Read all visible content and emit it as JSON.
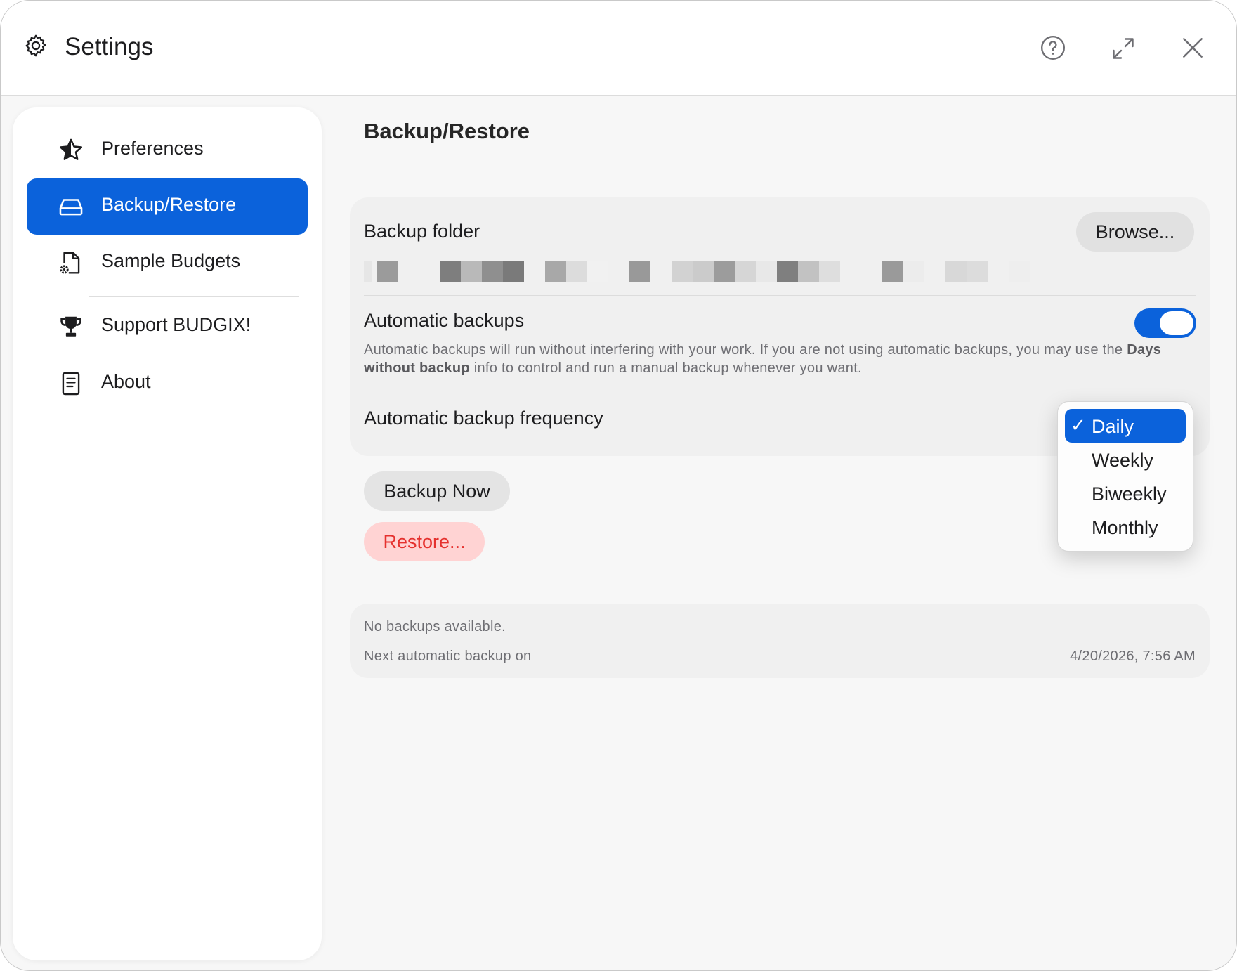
{
  "window": {
    "title": "Settings",
    "controls": [
      "help-icon",
      "expand-icon",
      "close-icon"
    ]
  },
  "sidebar": {
    "items": [
      {
        "label": "Preferences",
        "icon": "star-icon",
        "active": false
      },
      {
        "label": "Backup/Restore",
        "icon": "drive-icon",
        "active": true
      },
      {
        "label": "Sample Budgets",
        "icon": "document-gear-icon",
        "active": false
      },
      {
        "label": "Support BUDGIX!",
        "icon": "trophy-icon",
        "active": false
      },
      {
        "label": "About",
        "icon": "document-text-icon",
        "active": false
      }
    ]
  },
  "main": {
    "title": "Backup/Restore",
    "backup_folder": {
      "label": "Backup folder",
      "browse_label": "Browse..."
    },
    "automatic_backups": {
      "label": "Automatic backups",
      "enabled": true,
      "description_part1": "Automatic backups will run without interfering with your work. If you are not using automatic backups, you may use the",
      "description_bold": "Days without backup",
      "description_part2": "info to control and run a manual backup whenever you want."
    },
    "frequency": {
      "label": "Automatic backup frequency",
      "options": [
        "Daily",
        "Weekly",
        "Biweekly",
        "Monthly"
      ],
      "selected": "Daily",
      "check_mark": "✓"
    },
    "backup_now_label": "Backup Now",
    "restore_label": "Restore...",
    "status": {
      "no_backups": "No backups available.",
      "next_label": "Next automatic backup on",
      "next_value": "4/20/2026, 7:56 AM"
    }
  },
  "colors": {
    "accent": "#0b62db",
    "restore_text": "#e5312e",
    "restore_bg": "#ffd3d3"
  }
}
